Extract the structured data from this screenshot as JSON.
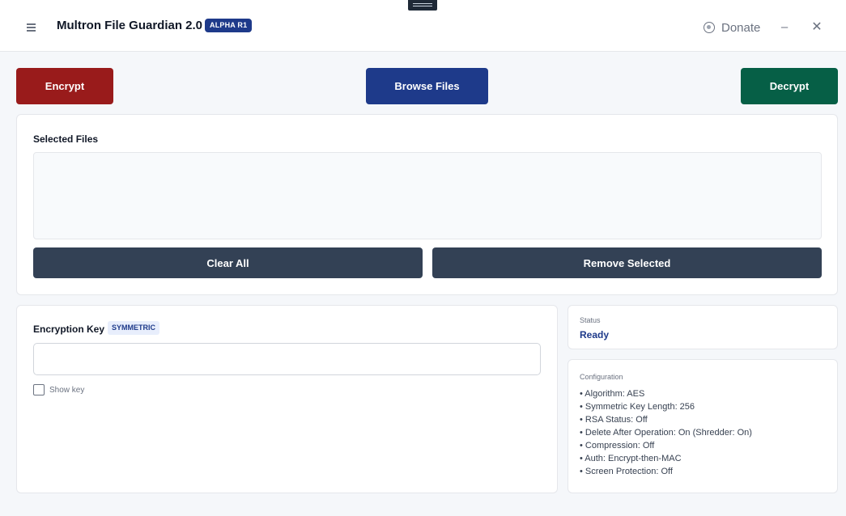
{
  "titlebar": {
    "title": "Multron File Guardian 2.0",
    "badge": "ALPHA R1",
    "donate_label": "Donate",
    "minimize_symbol": "–",
    "close_symbol": "✕"
  },
  "actions": {
    "encrypt_label": "Encrypt",
    "browse_label": "Browse Files",
    "decrypt_label": "Decrypt"
  },
  "files": {
    "section_title": "Selected Files",
    "items": [],
    "clear_label": "Clear All",
    "remove_label": "Remove Selected"
  },
  "key": {
    "section_title": "Encryption Key",
    "mode_badge": "SYMMETRIC",
    "value": "",
    "placeholder": "",
    "show_key_label": "Show key",
    "show_key_checked": false
  },
  "status": {
    "label": "Status",
    "value": "Ready"
  },
  "configuration": {
    "title": "Configuration",
    "lines": [
      "• Algorithm: AES",
      "• Symmetric Key Length: 256",
      "• RSA Status: Off",
      "• Delete After Operation: On (Shredder: On)",
      "• Compression: Off",
      "• Auth: Encrypt-then-MAC",
      "• Screen Protection: Off"
    ]
  },
  "colors": {
    "encrypt": "#991b1b",
    "browse": "#1e3a8a",
    "decrypt": "#065f46",
    "secondary_button": "#334155",
    "status_text": "#1e3a8a"
  },
  "icons": {
    "menu": "menu-icon",
    "donate": "donate-icon",
    "minimize": "minimize-icon",
    "close": "close-icon"
  }
}
